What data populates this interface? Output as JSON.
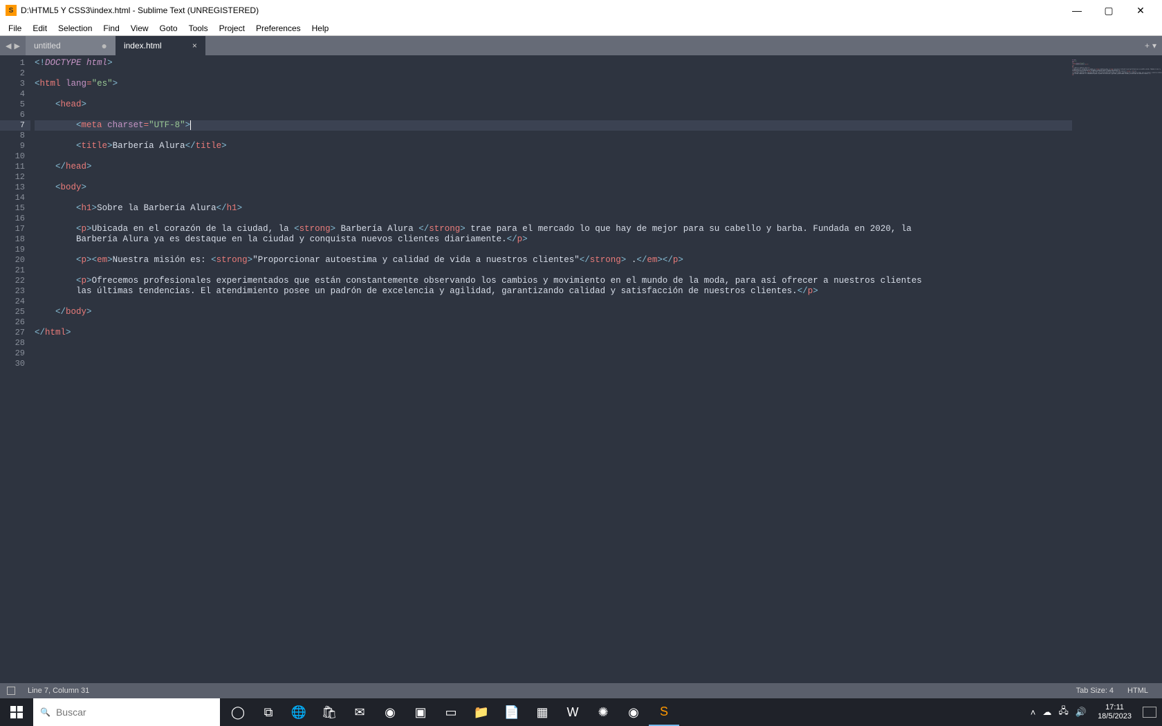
{
  "titlebar": {
    "app_icon_letter": "S",
    "title": "D:\\HTML5 Y CSS3\\index.html - Sublime Text (UNREGISTERED)",
    "min": "—",
    "max": "▢",
    "close": "✕"
  },
  "menu": {
    "items": [
      "File",
      "Edit",
      "Selection",
      "Find",
      "View",
      "Goto",
      "Tools",
      "Project",
      "Preferences",
      "Help"
    ]
  },
  "tabs": {
    "nav_back": "◀",
    "nav_fwd": "▶",
    "list": [
      {
        "label": "untitled",
        "active": false,
        "dirty": true
      },
      {
        "label": "index.html",
        "active": true,
        "dirty": false
      }
    ],
    "plus": "+",
    "more": "▾"
  },
  "editor": {
    "line_count": 30,
    "current_line": 7,
    "code": {
      "title_text": "Barbería Alura",
      "h1_text": "Sobre la Barbería Alura",
      "p1_a": "Ubicada en el corazón de la ciudad, la ",
      "p1_b": " Barbería Alura ",
      "p1_c": " trae para el mercado lo que hay de mejor para su cabello y barba. Fundada en 2020, la ",
      "p1_wrap": "Barbería Alura ya es destaque en la ciudad y conquista nuevos clientes diariamente.",
      "p2_a": "Nuestra misión es: ",
      "p2_b": "\"Proporcionar autoestima y calidad de vida a nuestros clientes\"",
      "p2_c": " .",
      "p3_a": "Ofrecemos profesionales experimentados que están constantemente observando los cambios y movimiento en el mundo de la moda, para así ofrecer a nuestros clientes ",
      "p3_wrap": "las últimas tendencias. El atendimiento posee un padrón de excelencia y agilidad, garantizando calidad y satisfacción de nuestros clientes."
    }
  },
  "status": {
    "pos": "Line 7, Column 31",
    "tabsize": "Tab Size: 4",
    "lang": "HTML"
  },
  "taskbar": {
    "search_placeholder": "Buscar",
    "time": "17:11",
    "date": "18/5/2023"
  }
}
